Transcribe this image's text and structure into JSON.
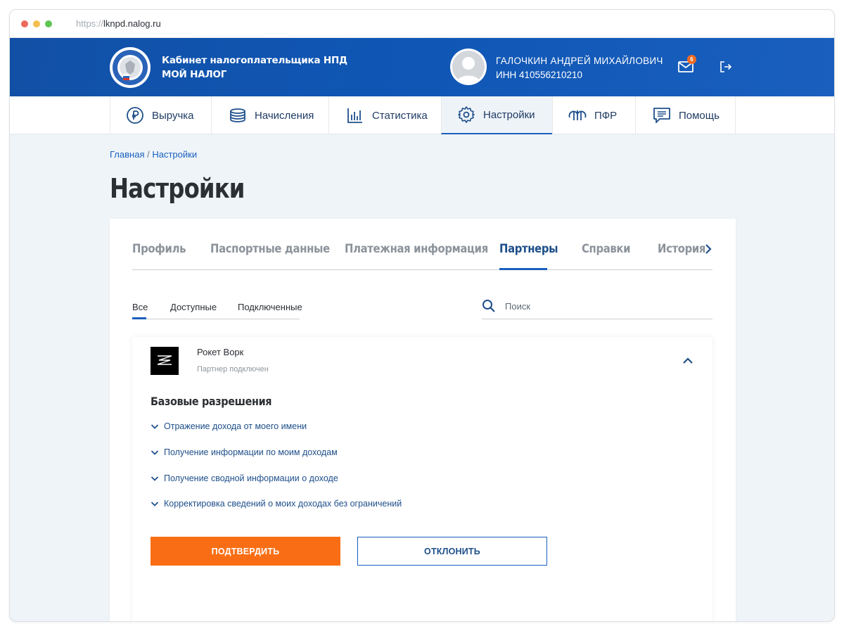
{
  "browser": {
    "url_protocol": "https://",
    "url_host": "lknpd.nalog.ru"
  },
  "header": {
    "brand_line1": "Кабинет налогоплательщика НПД",
    "brand_line2": "МОЙ НАЛОГ",
    "user_name": "ГАЛОЧКИН АНДРЕЙ МИХАЙЛОВИЧ",
    "user_inn": "ИНН 410556210210",
    "notifications_count": "6"
  },
  "nav": {
    "items": [
      {
        "label": "Выручка",
        "icon": "ruble-icon"
      },
      {
        "label": "Начисления",
        "icon": "coins-icon"
      },
      {
        "label": "Статистика",
        "icon": "bar-chart-icon"
      },
      {
        "label": "Настройки",
        "icon": "gear-icon",
        "active": true
      },
      {
        "label": "ПФР",
        "icon": "pfr-logo-icon"
      },
      {
        "label": "Помощь",
        "icon": "chat-icon"
      }
    ]
  },
  "breadcrumb": {
    "home": "Главная",
    "separator": "/",
    "current": "Настройки"
  },
  "page": {
    "title": "Настройки"
  },
  "tabs": {
    "items": [
      "Профиль",
      "Паспортные данные",
      "Платежная информация",
      "Партнеры",
      "Справки",
      "История"
    ],
    "active_index": 3
  },
  "filters": {
    "all": "Все",
    "available": "Доступные",
    "connected": "Подключенные",
    "active": "Все"
  },
  "search": {
    "placeholder": "Поиск",
    "value": ""
  },
  "partner": {
    "name": "Рокет Ворк",
    "status": "Партнер подключен",
    "permissions_title": "Базовые разрешения",
    "permissions": [
      "Отражение дохода от моего имени",
      "Получение информации по моим доходам",
      "Получение сводной информации о доходе",
      "Корректировка сведений о моих доходах без ограничений"
    ],
    "confirm_label": "ПОДТВЕРДИТЬ",
    "decline_label": "ОТКЛОНИТЬ"
  },
  "colors": {
    "header_blue": "#1250a6",
    "accent_blue": "#1a5fbd",
    "confirm_orange": "#f96e14",
    "badge_orange": "#f26a21"
  }
}
